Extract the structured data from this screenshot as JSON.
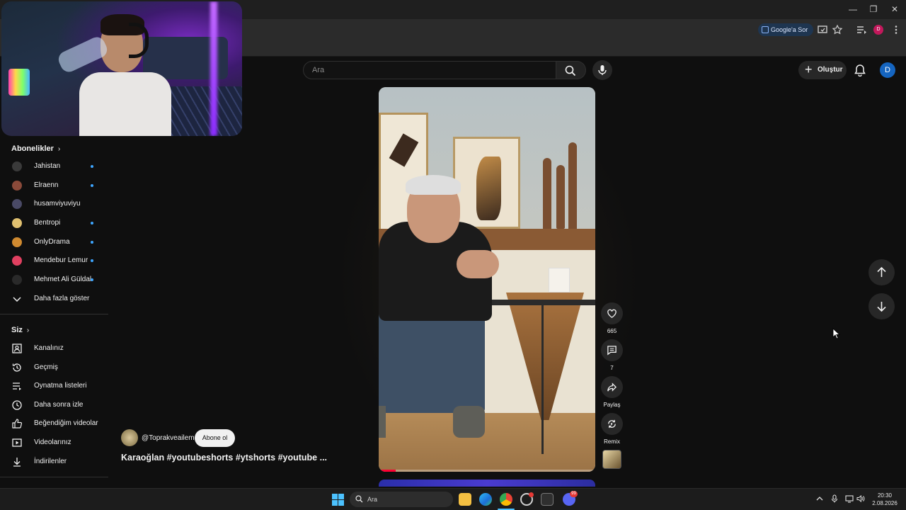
{
  "browser": {
    "google_ask_label": "Google'a Sor",
    "profile_initial": "D"
  },
  "masthead": {
    "search_placeholder": "Ara",
    "create_label": "Oluştur",
    "avatar_initial": "D"
  },
  "subscriptions": {
    "title": "Abonelikler",
    "items": [
      {
        "name": "Jahistan",
        "new": true,
        "color": "#3a3a3a"
      },
      {
        "name": "Elraenn",
        "new": true,
        "color": "#8a4a3a"
      },
      {
        "name": "husamviyuviyu",
        "new": false,
        "color": "#4a4a66"
      },
      {
        "name": "Bentropi",
        "new": true,
        "color": "#e0c070"
      },
      {
        "name": "OnlyDrama",
        "new": true,
        "color": "#d08a30"
      },
      {
        "name": "Mendebur Lemur",
        "new": true,
        "color": "#e04060"
      },
      {
        "name": "Mehmet Ali Güldal",
        "new": true,
        "color": "#2a2a2a"
      }
    ],
    "show_more": "Daha fazla göster"
  },
  "you": {
    "title": "Siz",
    "items": [
      {
        "label": "Kanalınız",
        "icon": "person-box-icon"
      },
      {
        "label": "Geçmiş",
        "icon": "history-icon"
      },
      {
        "label": "Oynatma listeleri",
        "icon": "playlist-icon"
      },
      {
        "label": "Daha sonra izle",
        "icon": "clock-icon"
      },
      {
        "label": "Beğendiğim videolar",
        "icon": "thumbs-up-icon"
      },
      {
        "label": "Videolarınız",
        "icon": "video-icon"
      },
      {
        "label": "İndirilenler",
        "icon": "download-icon"
      }
    ]
  },
  "short": {
    "channel": "@Toprakveailem",
    "subscribe_label": "Abone ol",
    "title": "Karaoğlan #youtubeshorts #ytshorts #youtube ...",
    "likes": "665",
    "comments": "7",
    "share_label": "Paylaş",
    "remix_label": "Remix",
    "progress": 0.08
  },
  "taskbar": {
    "search_label": "Ara",
    "time": "20:30",
    "date": "2.08.2026",
    "discord_badge": "99"
  },
  "colors": {
    "accent_blue": "#3ea6ff",
    "progress_red": "#ff0033",
    "background": "#0f0f0f"
  }
}
